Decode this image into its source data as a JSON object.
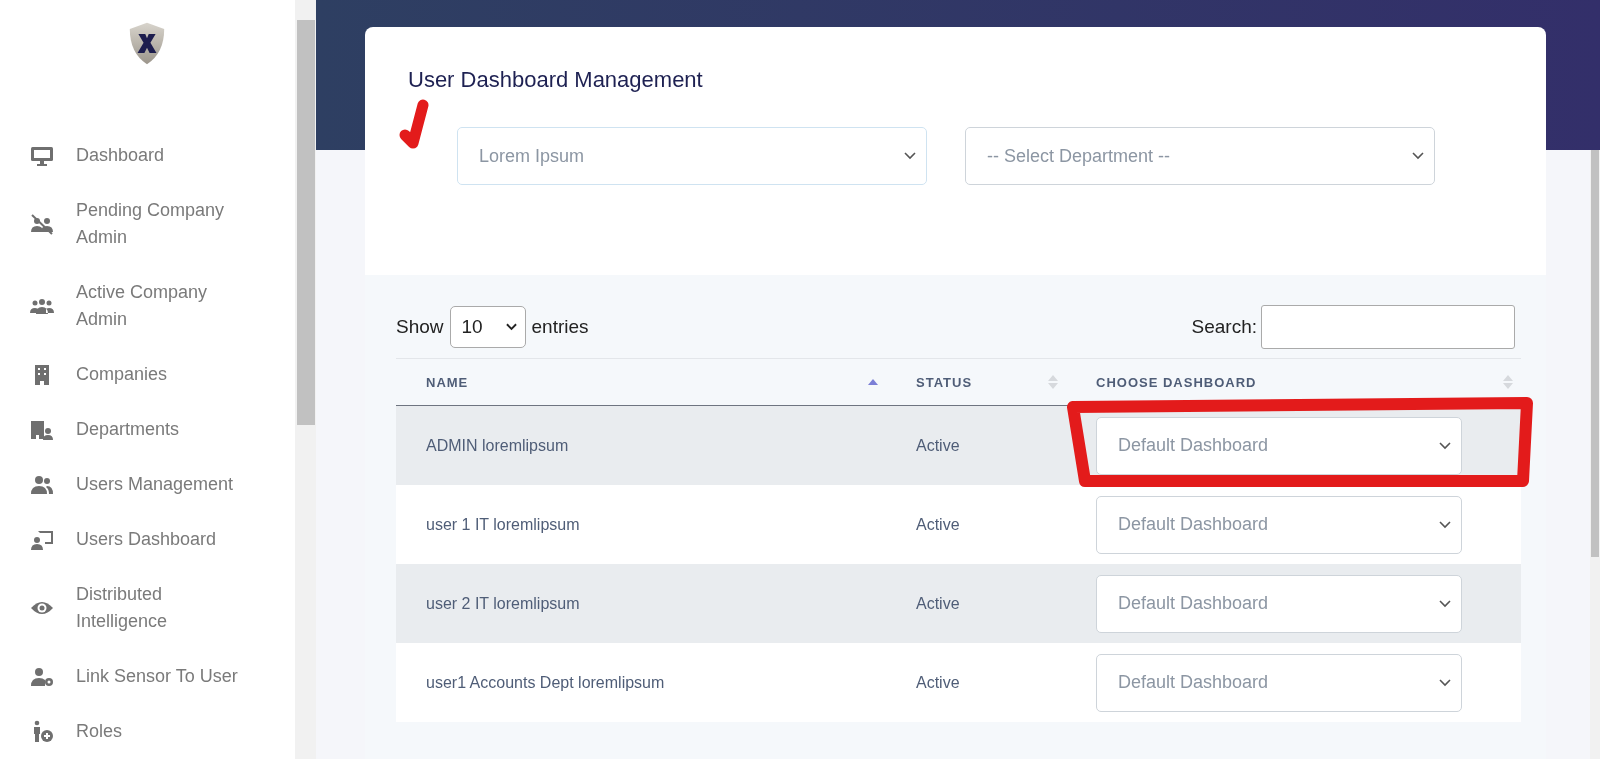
{
  "sidebar": {
    "items": [
      {
        "label": "Dashboard",
        "selected": false
      },
      {
        "label": "Pending Company Admin",
        "selected": false
      },
      {
        "label": "Active Company Admin",
        "selected": false
      },
      {
        "label": "Companies",
        "selected": false
      },
      {
        "label": "Departments",
        "selected": false
      },
      {
        "label": "Users Management",
        "selected": false
      },
      {
        "label": "Users Dashboard",
        "selected": false
      },
      {
        "label": "Distributed Intelligence",
        "selected": false
      },
      {
        "label": "Link Sensor To User",
        "selected": false
      },
      {
        "label": "Roles",
        "selected": false
      }
    ]
  },
  "page_title": "User Dashboard Management",
  "filters": [
    {
      "value": "Lorem Ipsum"
    },
    {
      "value": "-- Select Department --"
    }
  ],
  "table_controls": {
    "show_label": "Show",
    "page_size": "10",
    "entries_label": "entries",
    "search_label": "Search:"
  },
  "table": {
    "columns": [
      {
        "label": "NAME",
        "sorted": true
      },
      {
        "label": "STATUS",
        "sorted": false
      },
      {
        "label": "CHOOSE DASHBOARD",
        "sorted": false
      }
    ],
    "rows": [
      {
        "name": "ADMIN loremlipsum",
        "status": "Active",
        "dashboard": "Default Dashboard"
      },
      {
        "name": "user 1 IT loremlipsum",
        "status": "Active",
        "dashboard": "Default Dashboard"
      },
      {
        "name": "user 2 IT loremlipsum",
        "status": "Active",
        "dashboard": "Default Dashboard"
      },
      {
        "name": "user1 Accounts Dept loremlipsum",
        "status": "Active",
        "dashboard": "Default Dashboard"
      }
    ]
  }
}
